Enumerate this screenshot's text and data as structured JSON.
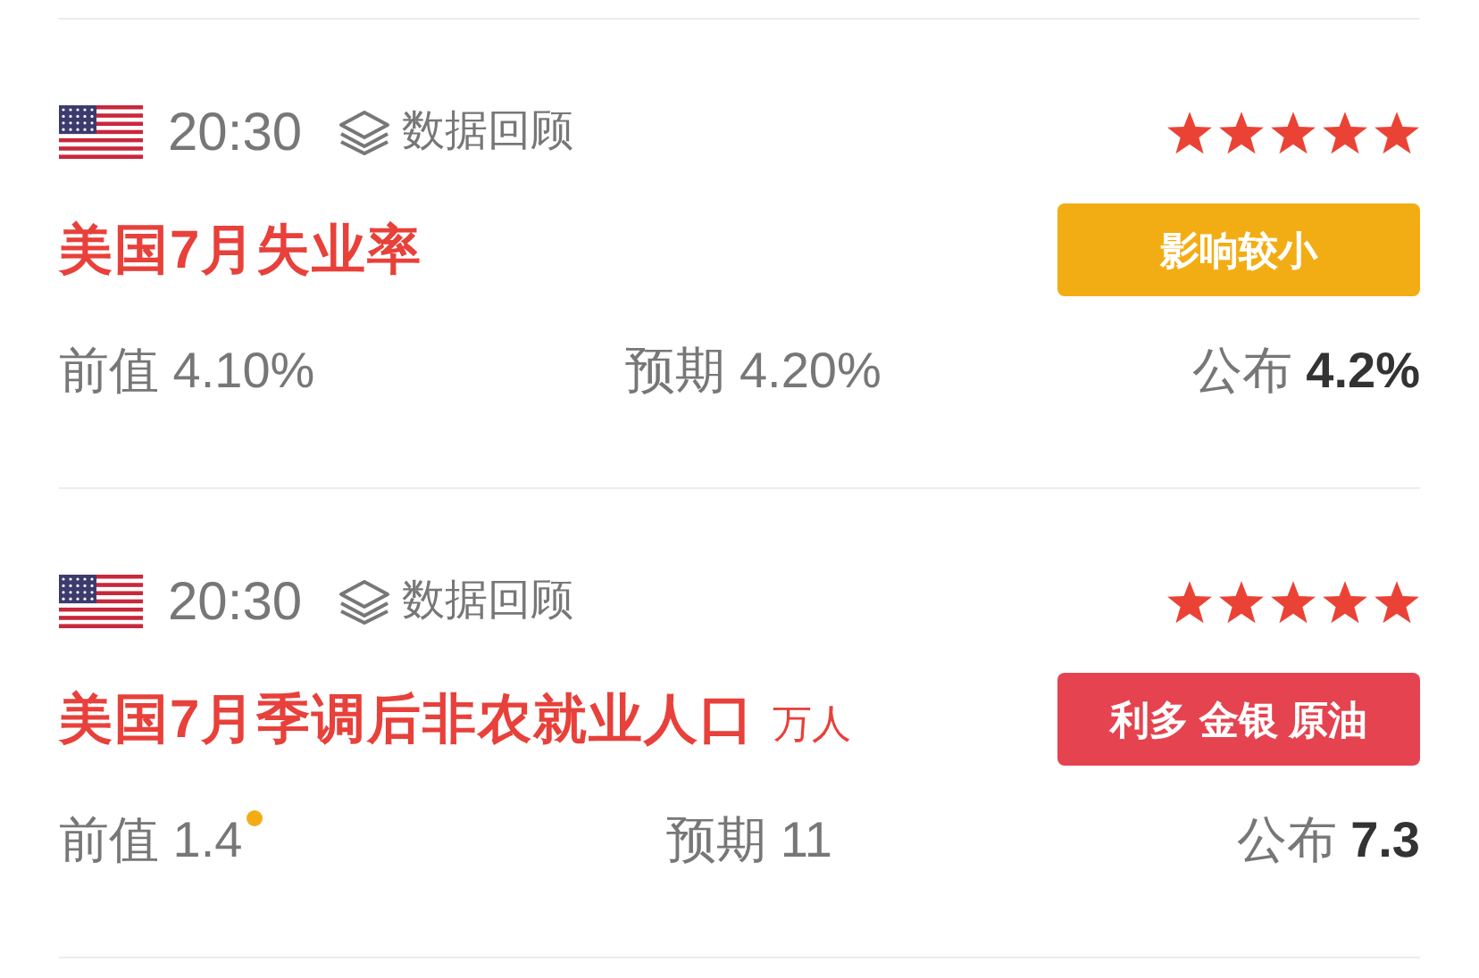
{
  "events": [
    {
      "time": "20:30",
      "tag": "数据回顾",
      "stars": 5,
      "title": "美国7月失业率",
      "impact": {
        "label": "影响较小",
        "color": "#f3ad14"
      },
      "previous": {
        "label": "前值",
        "value": "4.10%",
        "revised": false
      },
      "forecast": {
        "label": "预期",
        "value": "4.20%"
      },
      "actual": {
        "label": "公布",
        "value": "4.2%"
      }
    },
    {
      "time": "20:30",
      "tag": "数据回顾",
      "stars": 5,
      "title": "美国7月季调后非农就业人口",
      "unit": "万人",
      "impact": {
        "label": "利多 金银 原油",
        "color": "#e5434f"
      },
      "previous": {
        "label": "前值",
        "value": "1.4",
        "revised": true
      },
      "forecast": {
        "label": "预期",
        "value": "11"
      },
      "actual": {
        "label": "公布",
        "value": "7.3"
      }
    }
  ]
}
